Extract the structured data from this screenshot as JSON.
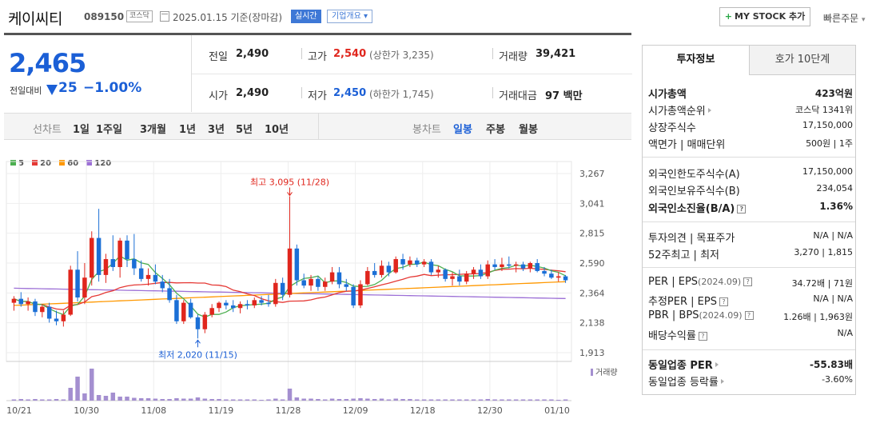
{
  "header": {
    "name": "케이씨티",
    "code": "089150",
    "market": "코스닥",
    "date": "2025.01.15 기준(장마감)",
    "realtime": "실시간",
    "company_info": "기업개요",
    "mystock": "MY STOCK 추가",
    "quick_order": "빠른주문"
  },
  "price": {
    "now": "2,465",
    "compare_label": "전일대비",
    "diff": "25",
    "rate": "−1.00%"
  },
  "quotes": {
    "prev_label": "전일",
    "prev": "2,490",
    "high_label": "고가",
    "high": "2,540",
    "upper_limit": "(상한가 3,235)",
    "volume_label": "거래량",
    "volume": "39,421",
    "open_label": "시가",
    "open": "2,490",
    "low_label": "저가",
    "low": "2,450",
    "lower_limit": "(하한가 1,745)",
    "amount_label": "거래대금",
    "amount": "97 백만"
  },
  "toolbar": {
    "line_label": "선차트",
    "line_periods": [
      "1일",
      "1주일",
      "3개월",
      "1년",
      "3년",
      "5년",
      "10년"
    ],
    "candle_label": "봉차트",
    "candle_periods": [
      "일봉",
      "주봉",
      "월봉"
    ],
    "active_candle": "일봉"
  },
  "chart_data": {
    "type": "candlestick",
    "legend": [
      "5",
      "20",
      "60",
      "120"
    ],
    "colors": {
      "up": "#e0261d",
      "down": "#1b6fd6",
      "ma5": "#4caf50",
      "ma20": "#e53935",
      "ma60": "#ff9800",
      "ma120": "#9c6fd6"
    },
    "y_ticks": [
      "3,267",
      "3,041",
      "2,815",
      "2,590",
      "2,364",
      "2,138",
      "1,913"
    ],
    "ylim": [
      1913,
      3267
    ],
    "x_ticks": [
      "10/21",
      "10/30",
      "11/08",
      "11/19",
      "11/28",
      "12/09",
      "12/18",
      "12/30",
      "01/10"
    ],
    "volume_label": "거래량",
    "max_annotation": "최고 3,095 (11/28)",
    "min_annotation": "최저 2,020 (11/15)",
    "candles": [
      [
        2290,
        2340,
        2230,
        2320
      ],
      [
        2320,
        2370,
        2260,
        2280
      ],
      [
        2280,
        2330,
        2230,
        2300
      ],
      [
        2300,
        2320,
        2190,
        2220
      ],
      [
        2220,
        2280,
        2180,
        2260
      ],
      [
        2260,
        2290,
        2140,
        2170
      ],
      [
        2170,
        2230,
        2120,
        2150
      ],
      [
        2150,
        2230,
        2110,
        2200
      ],
      [
        2200,
        2570,
        2190,
        2540
      ],
      [
        2540,
        2680,
        2300,
        2330
      ],
      [
        2330,
        2590,
        2280,
        2480
      ],
      [
        2480,
        2830,
        2420,
        2780
      ],
      [
        2780,
        3000,
        2450,
        2500
      ],
      [
        2500,
        2660,
        2440,
        2620
      ],
      [
        2620,
        2800,
        2530,
        2560
      ],
      [
        2560,
        2780,
        2480,
        2760
      ],
      [
        2760,
        2800,
        2560,
        2620
      ],
      [
        2620,
        2810,
        2500,
        2550
      ],
      [
        2550,
        2610,
        2450,
        2470
      ],
      [
        2470,
        2550,
        2420,
        2500
      ],
      [
        2500,
        2580,
        2430,
        2450
      ],
      [
        2450,
        2500,
        2370,
        2400
      ],
      [
        2400,
        2470,
        2290,
        2310
      ],
      [
        2310,
        2350,
        2130,
        2150
      ],
      [
        2150,
        2310,
        2130,
        2290
      ],
      [
        2290,
        2320,
        2170,
        2180
      ],
      [
        2180,
        2200,
        2020,
        2090
      ],
      [
        2090,
        2220,
        2060,
        2200
      ],
      [
        2200,
        2280,
        2180,
        2250
      ],
      [
        2250,
        2300,
        2220,
        2290
      ],
      [
        2290,
        2310,
        2240,
        2270
      ],
      [
        2270,
        2310,
        2220,
        2250
      ],
      [
        2250,
        2300,
        2210,
        2280
      ],
      [
        2280,
        2310,
        2240,
        2270
      ],
      [
        2270,
        2330,
        2250,
        2310
      ],
      [
        2310,
        2340,
        2270,
        2290
      ],
      [
        2290,
        2350,
        2260,
        2280
      ],
      [
        2280,
        2470,
        2260,
        2440
      ],
      [
        2440,
        2480,
        2310,
        2350
      ],
      [
        2350,
        3095,
        2330,
        2700
      ],
      [
        2700,
        2730,
        2420,
        2460
      ],
      [
        2460,
        2510,
        2400,
        2420
      ],
      [
        2420,
        2500,
        2380,
        2470
      ],
      [
        2470,
        2490,
        2380,
        2410
      ],
      [
        2410,
        2480,
        2380,
        2450
      ],
      [
        2450,
        2560,
        2430,
        2520
      ],
      [
        2520,
        2560,
        2400,
        2430
      ],
      [
        2430,
        2470,
        2380,
        2410
      ],
      [
        2410,
        2430,
        2250,
        2270
      ],
      [
        2270,
        2460,
        2250,
        2430
      ],
      [
        2430,
        2560,
        2420,
        2530
      ],
      [
        2530,
        2590,
        2480,
        2500
      ],
      [
        2500,
        2610,
        2480,
        2570
      ],
      [
        2570,
        2600,
        2490,
        2520
      ],
      [
        2520,
        2640,
        2510,
        2620
      ],
      [
        2620,
        2660,
        2540,
        2580
      ],
      [
        2580,
        2640,
        2560,
        2610
      ],
      [
        2610,
        2630,
        2560,
        2580
      ],
      [
        2580,
        2620,
        2560,
        2600
      ],
      [
        2600,
        2620,
        2500,
        2520
      ],
      [
        2520,
        2570,
        2480,
        2540
      ],
      [
        2540,
        2550,
        2450,
        2470
      ],
      [
        2470,
        2520,
        2420,
        2490
      ],
      [
        2490,
        2540,
        2420,
        2450
      ],
      [
        2450,
        2530,
        2430,
        2510
      ],
      [
        2510,
        2560,
        2470,
        2540
      ],
      [
        2540,
        2580,
        2470,
        2490
      ],
      [
        2490,
        2610,
        2470,
        2580
      ],
      [
        2580,
        2620,
        2540,
        2560
      ],
      [
        2560,
        2630,
        2530,
        2580
      ],
      [
        2580,
        2640,
        2550,
        2570
      ],
      [
        2570,
        2600,
        2520,
        2580
      ],
      [
        2580,
        2600,
        2530,
        2550
      ],
      [
        2550,
        2600,
        2520,
        2590
      ],
      [
        2590,
        2620,
        2520,
        2530
      ],
      [
        2530,
        2560,
        2490,
        2510
      ],
      [
        2510,
        2540,
        2470,
        2480
      ],
      [
        2480,
        2520,
        2450,
        2490
      ],
      [
        2490,
        2500,
        2440,
        2460
      ]
    ],
    "volumes": [
      3,
      4,
      3,
      4,
      3,
      3,
      4,
      3,
      32,
      60,
      18,
      80,
      14,
      12,
      20,
      10,
      10,
      7,
      6,
      6,
      5,
      4,
      4,
      6,
      5,
      5,
      8,
      5,
      4,
      4,
      3,
      3,
      3,
      3,
      3,
      2,
      3,
      5,
      3,
      30,
      8,
      5,
      5,
      4,
      3,
      5,
      4,
      4,
      5,
      6,
      5,
      4,
      5,
      3,
      5,
      4,
      4,
      3,
      3,
      3,
      3,
      3,
      3,
      3,
      3,
      3,
      3,
      4,
      3,
      3,
      3,
      3,
      3,
      3,
      3,
      3,
      3,
      2,
      3
    ]
  },
  "right_panel": {
    "tab_info": "투자정보",
    "tab_quote": "호가 10단계",
    "rows1": [
      {
        "k": "시가총액",
        "v": "423억원"
      },
      {
        "k": "시가총액순위",
        "v": "코스닥 1341위"
      },
      {
        "k": "상장주식수",
        "v": "17,150,000"
      },
      {
        "k": "액면가 | 매매단위",
        "v": "500원 | 1주"
      }
    ],
    "rows2": [
      {
        "k": "외국인한도주식수(A)",
        "v": "17,150,000"
      },
      {
        "k": "외국인보유주식수(B)",
        "v": "234,054"
      },
      {
        "k": "외국인소진율(B/A)",
        "v": "1.36%"
      }
    ],
    "rows3": [
      {
        "k": "투자의견 | 목표주가",
        "v": "N/A | N/A"
      },
      {
        "k": "52주최고 | 최저",
        "v": "3,270 | 1,815"
      }
    ],
    "rows4": [
      {
        "k": "PER | EPS",
        "k_sub": "(2024.09)",
        "v": "34.72배 | 71원"
      },
      {
        "k": "추정PER | EPS",
        "v": "N/A | N/A"
      },
      {
        "k": "PBR | BPS",
        "k_sub": "(2024.09)",
        "v": "1.26배 | 1,963원"
      },
      {
        "k": "배당수익률",
        "v": "N/A"
      }
    ],
    "rows5": [
      {
        "k": "동일업종 PER",
        "v": "-55.83배"
      },
      {
        "k": "동일업종 등락률",
        "v": "-3.60%"
      }
    ]
  }
}
